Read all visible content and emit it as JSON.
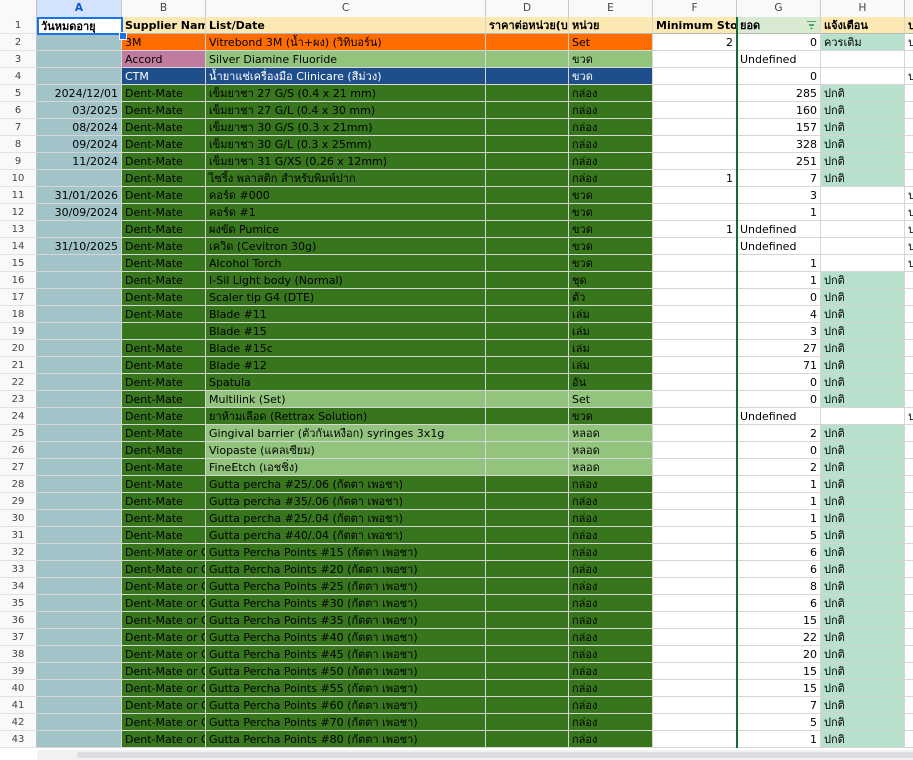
{
  "columns": [
    "A",
    "B",
    "C",
    "D",
    "E",
    "F",
    "G",
    "H",
    "I"
  ],
  "header": {
    "row_number": "1",
    "A": "วันหมดอายุ",
    "B": "Supplier Name",
    "C": "List/Date",
    "D": "ราคาต่อหน่วย(บ",
    "E": "หน่วย",
    "F": "Minimum Stock",
    "G": "ยอด",
    "H": "แจ้งเตือน",
    "I": "ป"
  },
  "colors": {
    "dark_green": "#38761d",
    "light_green": "#93c47d",
    "orange": "#ff6d01",
    "pink": "#c27ba0",
    "navy": "#1f4e8c",
    "gray_blue": "#a2c4c9",
    "mint": "#b7e1cd",
    "header_yellow": "#fce8b2"
  },
  "rows": [
    {
      "n": "2",
      "a": "",
      "b": "3M",
      "c": "Vitrebond 3M (น้ำ+ผง) (วิทิบอร์น)",
      "d": "",
      "e": "Set",
      "f": "2",
      "g": "0",
      "h": "ควรเติม",
      "i": "ป",
      "bg": "orange"
    },
    {
      "n": "3",
      "a": "",
      "b": "Accord",
      "c": "Silver Diamine Fluoride",
      "d": "",
      "e": "ขวด",
      "f": "",
      "g": "Undefined",
      "h": "",
      "i": "",
      "bg": "light",
      "bbg": "pink"
    },
    {
      "n": "4",
      "a": "",
      "b": "CTM",
      "c": "น้ำยาแช่เครื่องมือ Clinicare (สีม่วง)",
      "d": "",
      "e": "ขวด",
      "f": "",
      "g": "0",
      "h": "",
      "i": "ป",
      "bg": "navy"
    },
    {
      "n": "5",
      "a": "2024/12/01",
      "b": "Dent-Mate",
      "c": "เข็มยาชา 27 G/S (0.4 x 21 mm)",
      "d": "",
      "e": "กล่อง",
      "f": "",
      "g": "285",
      "h": "ปกติ",
      "i": "",
      "bg": "dark"
    },
    {
      "n": "6",
      "a": "03/2025",
      "b": "Dent-Mate",
      "c": "เข็มยาชา 27 G/L (0.4 x 30 mm)",
      "d": "",
      "e": "กล่อง",
      "f": "",
      "g": "160",
      "h": "ปกติ",
      "i": "",
      "bg": "dark"
    },
    {
      "n": "7",
      "a": "08/2024",
      "b": "Dent-Mate",
      "c": "เข็มยาชา 30 G/S (0.3 x 21mm)",
      "d": "",
      "e": "กล่อง",
      "f": "",
      "g": "157",
      "h": "ปกติ",
      "i": "",
      "bg": "dark"
    },
    {
      "n": "8",
      "a": "09/2024",
      "b": "Dent-Mate",
      "c": "เข็มยาชา 30 G/L (0.3 x 25mm)",
      "d": "",
      "e": "กล่อง",
      "f": "",
      "g": "328",
      "h": "ปกติ",
      "i": "",
      "bg": "dark"
    },
    {
      "n": "9",
      "a": "11/2024",
      "b": "Dent-Mate",
      "c": "เข็มยาชา 31 G/XS (0.26 x 12mm)",
      "d": "",
      "e": "กล่อง",
      "f": "",
      "g": "251",
      "h": "ปกติ",
      "i": "",
      "bg": "dark"
    },
    {
      "n": "10",
      "a": "",
      "b": "Dent-Mate",
      "c": "ไซริ้ง พลาสติก สำหรับพิมพ์ปาก",
      "d": "",
      "e": "กล่อง",
      "f": "1",
      "g": "7",
      "h": "ปกติ",
      "i": "",
      "bg": "dark"
    },
    {
      "n": "11",
      "a": "31/01/2026",
      "b": "Dent-Mate",
      "c": "คอร์ด #000",
      "d": "",
      "e": "ขวด",
      "f": "",
      "g": "3",
      "h": "",
      "i": "ป",
      "bg": "dark"
    },
    {
      "n": "12",
      "a": "30/09/2024",
      "b": "Dent-Mate",
      "c": "คอร์ด #1",
      "d": "",
      "e": "ขวด",
      "f": "",
      "g": "1",
      "h": "",
      "i": "ป",
      "bg": "dark"
    },
    {
      "n": "13",
      "a": "",
      "b": "Dent-Mate",
      "c": "ผงขัด Pumice",
      "d": "",
      "e": "ขวด",
      "f": "1",
      "g": "Undefined",
      "h": "",
      "i": "ป",
      "bg": "dark"
    },
    {
      "n": "14",
      "a": "31/10/2025",
      "b": "Dent-Mate",
      "c": "เควิด (Cevitron 30g)",
      "d": "",
      "e": "ขวด",
      "f": "",
      "g": "Undefined",
      "h": "",
      "i": "ป",
      "bg": "dark"
    },
    {
      "n": "15",
      "a": "",
      "b": "Dent-Mate",
      "c": "Alcohol Torch",
      "d": "",
      "e": "ขวด",
      "f": "",
      "g": "1",
      "h": "",
      "i": "ป",
      "bg": "dark"
    },
    {
      "n": "16",
      "a": "",
      "b": "Dent-Mate",
      "c": "I-Sil Light body (Normal)",
      "d": "",
      "e": "ชุด",
      "f": "",
      "g": "1",
      "h": "ปกติ",
      "i": "",
      "bg": "dark"
    },
    {
      "n": "17",
      "a": "",
      "b": "Dent-Mate",
      "c": "Scaler tip G4 (DTE)",
      "d": "",
      "e": "ตัว",
      "f": "",
      "g": "0",
      "h": "ปกติ",
      "i": "",
      "bg": "dark"
    },
    {
      "n": "18",
      "a": "",
      "b": "Dent-Mate",
      "c": "Blade #11",
      "d": "",
      "e": "เล่ม",
      "f": "",
      "g": "4",
      "h": "ปกติ",
      "i": "",
      "bg": "dark"
    },
    {
      "n": "19",
      "a": "",
      "b": "",
      "c": "Blade #15",
      "d": "",
      "e": "เล่ม",
      "f": "",
      "g": "3",
      "h": "ปกติ",
      "i": "",
      "bg": "dark"
    },
    {
      "n": "20",
      "a": "",
      "b": "Dent-Mate",
      "c": "Blade #15c",
      "d": "",
      "e": "เล่ม",
      "f": "",
      "g": "27",
      "h": "ปกติ",
      "i": "",
      "bg": "dark"
    },
    {
      "n": "21",
      "a": "",
      "b": "Dent-Mate",
      "c": "Blade #12",
      "d": "",
      "e": "เล่ม",
      "f": "",
      "g": "71",
      "h": "ปกติ",
      "i": "",
      "bg": "dark"
    },
    {
      "n": "22",
      "a": "",
      "b": "Dent-Mate",
      "c": "Spatula",
      "d": "",
      "e": "อัน",
      "f": "",
      "g": "0",
      "h": "ปกติ",
      "i": "",
      "bg": "dark"
    },
    {
      "n": "23",
      "a": "",
      "b": "Dent-Mate",
      "c": "Multilink (Set)",
      "d": "",
      "e": "Set",
      "f": "",
      "g": "0",
      "h": "ปกติ",
      "i": "",
      "bg": "lightc"
    },
    {
      "n": "24",
      "a": "",
      "b": "Dent-Mate",
      "c": "ยาห้ามเลือด (Rettrax Solution)",
      "d": "",
      "e": "ขวด",
      "f": "",
      "g": "Undefined",
      "h": "",
      "i": "ป",
      "bg": "dark"
    },
    {
      "n": "25",
      "a": "",
      "b": "Dent-Mate",
      "c": "Gingival barrier (ตัวกันเหงือก) syringes 3x1g",
      "d": "",
      "e": "หลอด",
      "f": "",
      "g": "2",
      "h": "ปกติ",
      "i": "",
      "bg": "lightc"
    },
    {
      "n": "26",
      "a": "",
      "b": "Dent-Mate",
      "c": "Viopaste (แคลเซียม)",
      "d": "",
      "e": "หลอด",
      "f": "",
      "g": "0",
      "h": "ปกติ",
      "i": "",
      "bg": "lightc"
    },
    {
      "n": "27",
      "a": "",
      "b": "Dent-Mate",
      "c": "FineEtch (เอชชิ่ง)",
      "d": "",
      "e": "หลอด",
      "f": "",
      "g": "2",
      "h": "ปกติ",
      "i": "",
      "bg": "lightc"
    },
    {
      "n": "28",
      "a": "",
      "b": "Dent-Mate",
      "c": "Gutta percha #25/.06 (กัตตา เพอชา)",
      "d": "",
      "e": "กล่อง",
      "f": "",
      "g": "1",
      "h": "ปกติ",
      "i": "",
      "bg": "dark"
    },
    {
      "n": "29",
      "a": "",
      "b": "Dent-Mate",
      "c": "Gutta percha #35/.06 (กัตตา เพอชา)",
      "d": "",
      "e": "กล่อง",
      "f": "",
      "g": "1",
      "h": "ปกติ",
      "i": "",
      "bg": "dark"
    },
    {
      "n": "30",
      "a": "",
      "b": "Dent-Mate",
      "c": "Gutta percha #25/.04 (กัตตา เพอชา)",
      "d": "",
      "e": "กล่อง",
      "f": "",
      "g": "1",
      "h": "ปกติ",
      "i": "",
      "bg": "dark"
    },
    {
      "n": "31",
      "a": "",
      "b": "Dent-Mate",
      "c": "Gutta percha #40/.04  (กัตตา เพอชา)",
      "d": "",
      "e": "กล่อง",
      "f": "",
      "g": "5",
      "h": "ปกติ",
      "i": "",
      "bg": "dark"
    },
    {
      "n": "32",
      "a": "",
      "b": "Dent-Mate or Oc",
      "c": "Gutta Percha Points #15 (กัตตา เพอชา)",
      "d": "",
      "e": "กล่อง",
      "f": "",
      "g": "6",
      "h": "ปกติ",
      "i": "",
      "bg": "dark"
    },
    {
      "n": "33",
      "a": "",
      "b": "Dent-Mate or Oc",
      "c": "Gutta Percha Points #20 (กัตตา เพอชา)",
      "d": "",
      "e": "กล่อง",
      "f": "",
      "g": "6",
      "h": "ปกติ",
      "i": "",
      "bg": "dark"
    },
    {
      "n": "34",
      "a": "",
      "b": "Dent-Mate or Oc",
      "c": "Gutta Percha Points #25 (กัตตา เพอชา)",
      "d": "",
      "e": "กล่อง",
      "f": "",
      "g": "8",
      "h": "ปกติ",
      "i": "",
      "bg": "dark"
    },
    {
      "n": "35",
      "a": "",
      "b": "Dent-Mate or Oc",
      "c": "Gutta Percha Points #30 (กัตตา เพอชา)",
      "d": "",
      "e": "กล่อง",
      "f": "",
      "g": "6",
      "h": "ปกติ",
      "i": "",
      "bg": "dark"
    },
    {
      "n": "36",
      "a": "",
      "b": "Dent-Mate or Oc",
      "c": "Gutta Percha Points #35 (กัตตา เพอชา)",
      "d": "",
      "e": "กล่อง",
      "f": "",
      "g": "15",
      "h": "ปกติ",
      "i": "",
      "bg": "dark"
    },
    {
      "n": "37",
      "a": "",
      "b": "Dent-Mate or Oc",
      "c": "Gutta Percha Points #40 (กัตตา เพอชา)",
      "d": "",
      "e": "กล่อง",
      "f": "",
      "g": "22",
      "h": "ปกติ",
      "i": "",
      "bg": "dark"
    },
    {
      "n": "38",
      "a": "",
      "b": "Dent-Mate or Oc",
      "c": "Gutta Percha Points #45 (กัตตา เพอชา)",
      "d": "",
      "e": "กล่อง",
      "f": "",
      "g": "20",
      "h": "ปกติ",
      "i": "",
      "bg": "dark"
    },
    {
      "n": "39",
      "a": "",
      "b": "Dent-Mate or Oc",
      "c": "Gutta Percha Points #50 (กัตตา เพอชา)",
      "d": "",
      "e": "กล่อง",
      "f": "",
      "g": "15",
      "h": "ปกติ",
      "i": "",
      "bg": "dark"
    },
    {
      "n": "40",
      "a": "",
      "b": "Dent-Mate or Oc",
      "c": "Gutta Percha Points #55 (กัตตา เพอชา)",
      "d": "",
      "e": "กล่อง",
      "f": "",
      "g": "15",
      "h": "ปกติ",
      "i": "",
      "bg": "dark"
    },
    {
      "n": "41",
      "a": "",
      "b": "Dent-Mate or Oc",
      "c": "Gutta Percha Points #60 (กัตตา เพอชา)",
      "d": "",
      "e": "กล่อง",
      "f": "",
      "g": "7",
      "h": "ปกติ",
      "i": "",
      "bg": "dark"
    },
    {
      "n": "42",
      "a": "",
      "b": "Dent-Mate or Oc",
      "c": "Gutta Percha Points #70 (กัตตา เพอชา)",
      "d": "",
      "e": "กล่อง",
      "f": "",
      "g": "5",
      "h": "ปกติ",
      "i": "",
      "bg": "dark"
    },
    {
      "n": "43",
      "a": "",
      "b": "Dent-Mate or Oc",
      "c": "Gutta Percha Points #80 (กัตตา เพอชา)",
      "d": "",
      "e": "กล่อง",
      "f": "",
      "g": "1",
      "h": "ปกติ",
      "i": "",
      "bg": "dark"
    }
  ]
}
